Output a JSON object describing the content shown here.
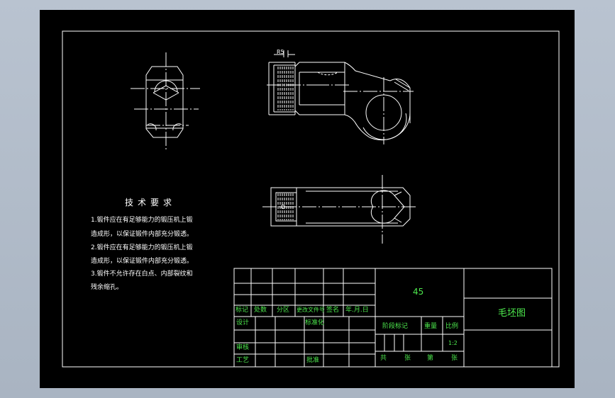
{
  "colors": {
    "background": "#000000",
    "line": "#ffffff",
    "text_white": "#ffffff",
    "text_green": "#4de84d",
    "hatch": "#7a7a7a"
  },
  "dimension": {
    "label": "R5"
  },
  "notes": {
    "title": "技术要求",
    "lines": [
      "1.锻件应在有足够能力的锻压机上锻",
      "造成形，以保证锻件内部充分锻透。",
      "2.锻件应在有足够能力的锻压机上锻",
      "造成形，以保证锻件内部充分锻透。",
      "3.锻件不允许存在白点、内部裂纹和",
      "残余缩孔。"
    ]
  },
  "title_block": {
    "material": "45",
    "drawing_name": "毛坯图",
    "row_labels": {
      "biaoji": "标记",
      "chushu": "处数",
      "fenqu": "分区",
      "gengai": "更改文件号",
      "qianming": "签名",
      "date": "年.月.日"
    },
    "sheji": "设计",
    "biaozhunhua": "标准化",
    "shenhe": "审核",
    "gongyi": "工艺",
    "pizhun": "批准",
    "stage_mark": "阶段标记",
    "weight": "重量",
    "scale_label": "比例",
    "scale_value": "1:2",
    "gong": "共",
    "zhang1": "张",
    "di": "第",
    "zhang2": "张"
  }
}
